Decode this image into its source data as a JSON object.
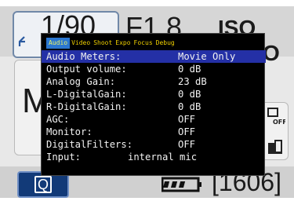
{
  "camera": {
    "shutter": "1/90",
    "aperture": "F1.8",
    "iso": "ISO AUTO",
    "mode_letter": "M",
    "shots_remaining": "[1606]",
    "q_button_label": "Q"
  },
  "menu": {
    "tabs": [
      {
        "label": "Audio",
        "active": true
      },
      {
        "label": "Video"
      },
      {
        "label": "Shoot"
      },
      {
        "label": "Expo"
      },
      {
        "label": "Focus"
      },
      {
        "label": "Debug"
      }
    ],
    "items": [
      {
        "label": "Audio Meters:",
        "value": "Movie Only",
        "selected": true
      },
      {
        "label": "Output volume:",
        "value": "0 dB"
      },
      {
        "label": "Analog Gain:",
        "value": "23 dB"
      },
      {
        "label": "L-DigitalGain:",
        "value": "0 dB"
      },
      {
        "label": "R-DigitalGain:",
        "value": "0 dB"
      },
      {
        "label": "AGC:",
        "value": "OFF"
      },
      {
        "label": "Monitor:",
        "value": "OFF"
      },
      {
        "label": "DigitalFilters:",
        "value": "OFF"
      },
      {
        "label": "Input:",
        "value": "internal mic"
      }
    ]
  },
  "colors": {
    "menu_bg": "#000000",
    "tab_text": "#f0d000",
    "active_tab_bg": "#2b77d0",
    "selected_row_bg": "#2430a6",
    "item_text": "#f2f2f2"
  }
}
